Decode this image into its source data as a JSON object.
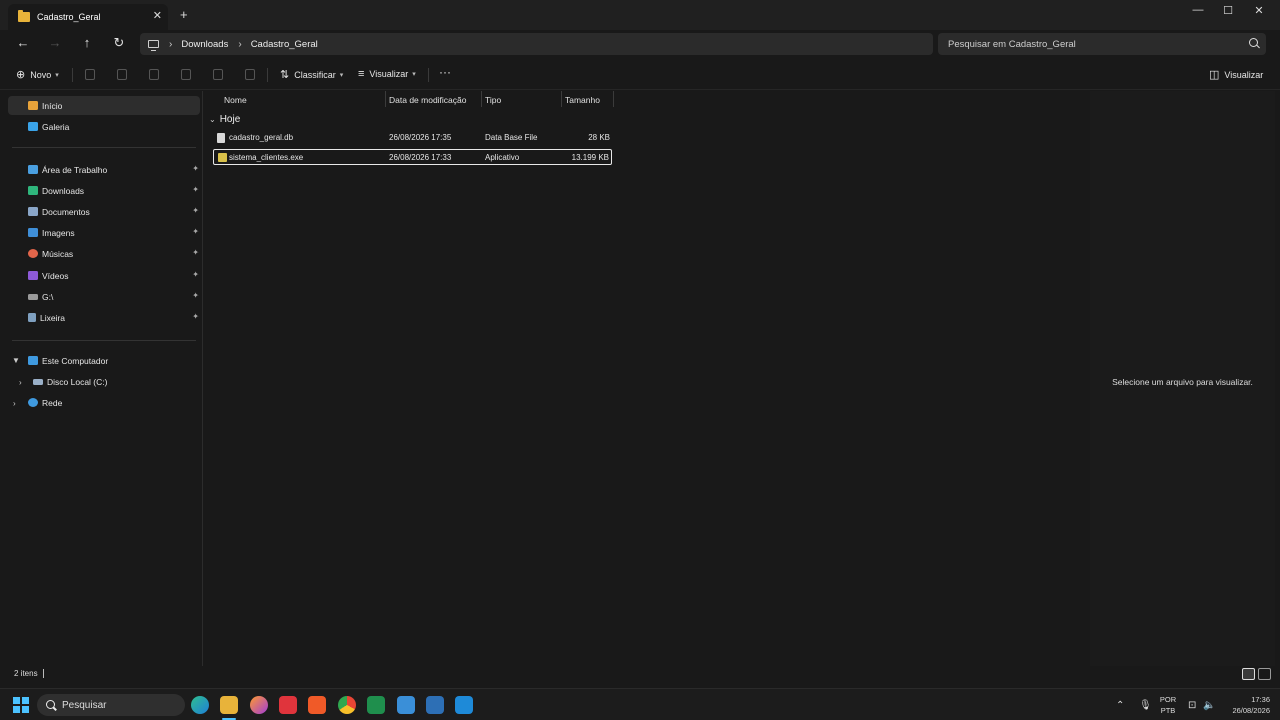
{
  "window": {
    "tab_title": "Cadastro_Geral",
    "tab_close": "✕",
    "new_tab": "+",
    "minimize": "—",
    "maximize": "☐",
    "close": "✕"
  },
  "nav": {
    "back": "←",
    "forward": "→",
    "up": "↑",
    "refresh": "↻",
    "breadcrumb": [
      "Downloads",
      "Cadastro_Geral"
    ],
    "crumb_sep": "›",
    "search_placeholder": "Pesquisar em Cadastro_Geral"
  },
  "commands": {
    "new_label": "Novo",
    "sort_label": "Classificar",
    "view_label": "Visualizar",
    "more": "···",
    "preview_label": "Visualizar"
  },
  "sidebar": {
    "quick": [
      {
        "label": "Início",
        "icon": "home-icon",
        "color": "#e8a33a"
      },
      {
        "label": "Galeria",
        "icon": "gallery-icon",
        "color": "#3aa3e8"
      }
    ],
    "pinned": [
      {
        "label": "Área de Trabalho",
        "icon": "desktop-icon",
        "color": "#4a9fe0"
      },
      {
        "label": "Downloads",
        "icon": "downloads-icon",
        "color": "#2fb67c"
      },
      {
        "label": "Documentos",
        "icon": "documents-icon",
        "color": "#8aa6c8"
      },
      {
        "label": "Imagens",
        "icon": "pictures-icon",
        "color": "#3f8fd8"
      },
      {
        "label": "Músicas",
        "icon": "music-icon",
        "color": "#e2654a"
      },
      {
        "label": "Vídeos",
        "icon": "videos-icon",
        "color": "#8e5ad8"
      },
      {
        "label": "G:\\",
        "icon": "drive-icon",
        "color": "#9a9a9a"
      },
      {
        "label": "Lixeira",
        "icon": "recycle-bin-icon",
        "color": "#7fa0c0"
      }
    ],
    "pin_glyph": "📌",
    "tree": [
      {
        "label": "Este Computador",
        "icon": "this-pc-icon",
        "color": "#3f9ae0"
      },
      {
        "label": "Disco Local (C:)",
        "icon": "local-disk-icon",
        "color": "#9ab0c8"
      },
      {
        "label": "Rede",
        "icon": "network-icon",
        "color": "#3f9ae0"
      }
    ]
  },
  "filelist": {
    "columns": [
      "Nome",
      "Data de modificação",
      "Tipo",
      "Tamanho"
    ],
    "group": "Hoje",
    "rows": [
      {
        "name": "cadastro_geral.db",
        "date": "26/08/2026 17:35",
        "type": "Data Base File",
        "size": "28 KB",
        "icon_color": "#d8d8d8"
      },
      {
        "name": "sistema_clientes.exe",
        "date": "26/08/2026 17:33",
        "type": "Aplicativo",
        "size": "13.199 KB",
        "icon_color": "#d9c14a"
      }
    ]
  },
  "preview": {
    "message": "Selecione um arquivo para visualizar."
  },
  "status": {
    "count": "2 itens"
  },
  "taskbar": {
    "search_label": "Pesquisar",
    "lang_top": "POR",
    "lang_bottom": "PTB",
    "time": "17:36",
    "date": "26/08/2026"
  },
  "colors": {
    "accent": "#4cc2ff",
    "folder": "#e8b33a"
  }
}
